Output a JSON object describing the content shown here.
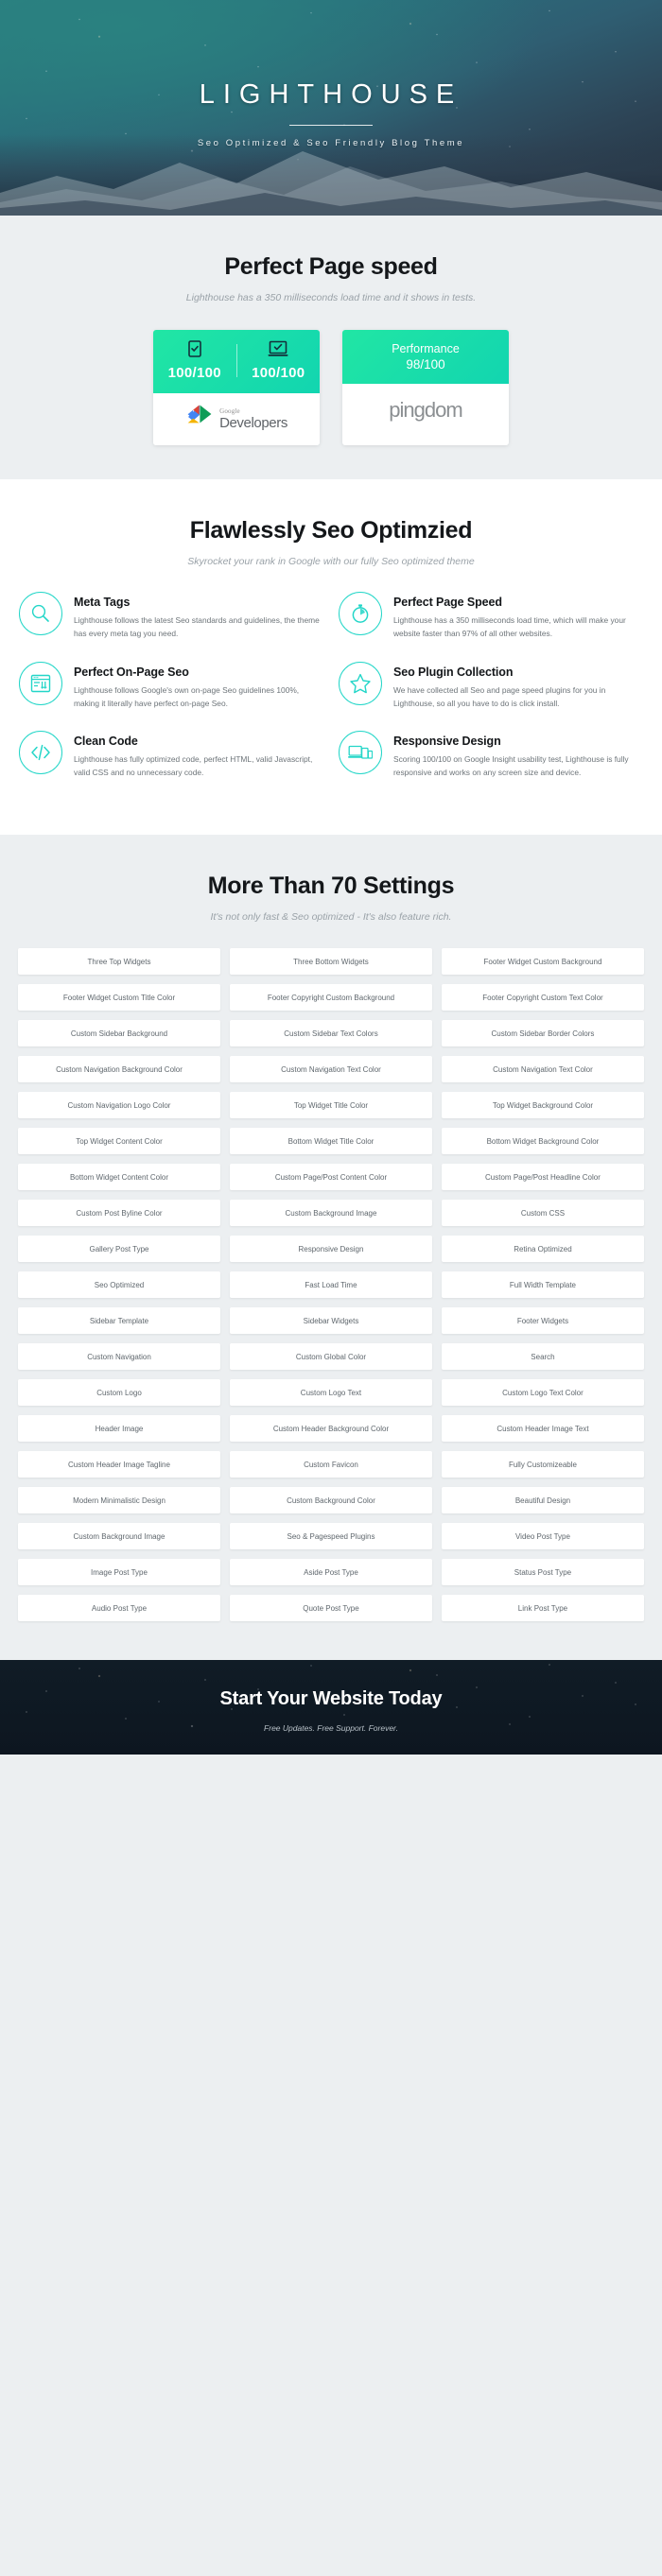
{
  "hero": {
    "title": "LIGHTHOUSE",
    "subtitle": "Seo Optimized & Seo Friendly Blog Theme"
  },
  "speed": {
    "title": "Perfect Page speed",
    "subtitle": "Lighthouse has a 350 milliseconds load time and it shows in tests.",
    "cards": [
      {
        "type": "google-developers",
        "mobile_icon": "mobile-check-icon",
        "mobile_score": "100/100",
        "desktop_icon": "desktop-check-icon",
        "desktop_score": "100/100",
        "brand_top": "Google",
        "brand_bottom": "Developers"
      },
      {
        "type": "pingdom",
        "label": "Performance",
        "score": "98/100",
        "brand": "pingdom"
      }
    ]
  },
  "seo": {
    "title": "Flawlessly Seo Optimzied",
    "subtitle": "Skyrocket your rank in Google with our fully Seo optimized theme",
    "features": [
      {
        "icon": "magnifier-icon",
        "title": "Meta Tags",
        "body": "Lighthouse follows the latest Seo standards and guidelines, the theme has every meta tag you need."
      },
      {
        "icon": "stopwatch-icon",
        "title": "Perfect Page Speed",
        "body": "Lighthouse has a 350 milliseconds load time, which will make your website faster than 97% of all other websites."
      },
      {
        "icon": "browser-tools-icon",
        "title": "Perfect On-Page Seo",
        "body": "Lighthouse follows Google's own on-page Seo guidelines 100%, making it literally have perfect on-page Seo."
      },
      {
        "icon": "star-icon",
        "title": "Seo Plugin Collection",
        "body": "We have collected all Seo and page speed plugins for you in Lighthouse, so all you have to do is click install."
      },
      {
        "icon": "code-brackets-icon",
        "title": "Clean Code",
        "body": "Lighthouse has fully optimized code, perfect HTML, valid Javascript, valid CSS and no unnecessary code."
      },
      {
        "icon": "devices-icon",
        "title": "Responsive Design",
        "body": "Scoring 100/100 on Google Insight usability test, Lighthouse is fully responsive and works on any screen size and device."
      }
    ]
  },
  "settings": {
    "title": "More Than 70 Settings",
    "subtitle": "It's not only fast & Seo optimized - It's also feature rich.",
    "items": [
      "Three Top Widgets",
      "Three Bottom Widgets",
      "Footer Widget Custom Background",
      "Footer Widget Custom Title Color",
      "Footer Copyright Custom Background",
      "Footer Copyright Custom Text Color",
      "Custom Sidebar Background",
      "Custom Sidebar Text Colors",
      "Custom Sidebar Border Colors",
      "Custom Navigation Background Color",
      "Custom Navigation Text Color",
      "Custom Navigation Text Color",
      "Custom Navigation Logo Color",
      "Top Widget Title Color",
      "Top Widget Background Color",
      "Top Widget Content Color",
      "Bottom Widget Title Color",
      "Bottom Widget Background Color",
      "Bottom Widget Content Color",
      "Custom Page/Post Content Color",
      "Custom Page/Post Headline Color",
      "Custom Post Byline Color",
      "Custom Background Image",
      "Custom CSS",
      "Gallery Post Type",
      "Responsive Design",
      "Retina Optimized",
      "Seo Optimized",
      "Fast Load Time",
      "Full Width Template",
      "Sidebar Template",
      "Sidebar Widgets",
      "Footer Widgets",
      "Custom Navigation",
      "Custom Global Color",
      "Search",
      "Custom Logo",
      "Custom Logo Text",
      "Custom Logo Text Color",
      "Header Image",
      "Custom Header Background Color",
      "Custom Header Image Text",
      "Custom Header Image Tagline",
      "Custom Favicon",
      "Fully Customizeable",
      "Modern Minimalistic Design",
      "Custom Background Color",
      "Beautiful Design",
      "Custom Background Image",
      "Seo & Pagespeed Plugins",
      "Video Post Type",
      "Image Post Type",
      "Aside Post Type",
      "Status Post Type",
      "Audio Post Type",
      "Quote Post Type",
      "Link Post Type"
    ]
  },
  "footer": {
    "title": "Start Your Website Today",
    "subtitle": "Free Updates. Free Support. Forever."
  },
  "colors": {
    "accent": "#23d6c8",
    "green_start": "#21e6a4",
    "green_end": "#12d5b0",
    "page_bg": "#eceff1",
    "footer_bg": "#101c26"
  }
}
